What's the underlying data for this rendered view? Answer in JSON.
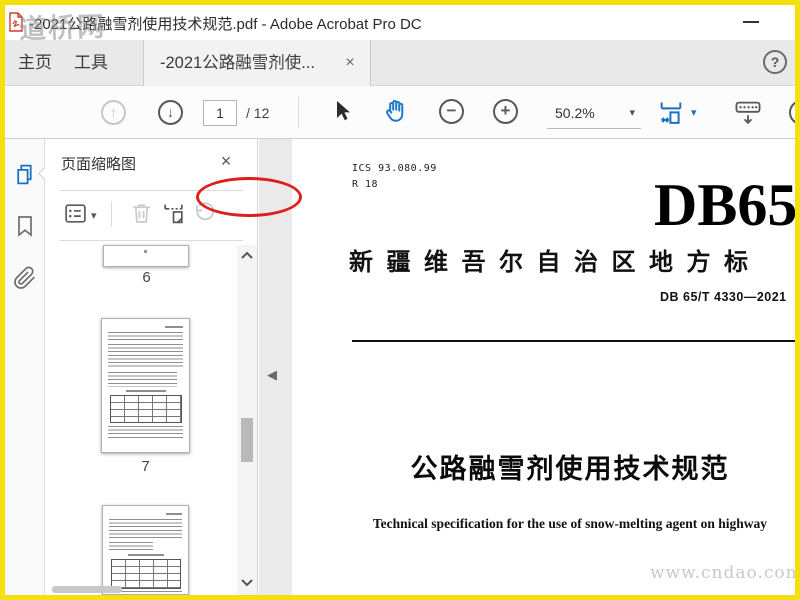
{
  "titlebar": {
    "watermark": "道桥网",
    "title": "-2021公路融雪剂使用技术规范.pdf - Adobe Acrobat Pro DC"
  },
  "tabbar": {
    "home_tab": "主页",
    "tools_tab": "工具",
    "doc_tab": "-2021公路融雪剂使...",
    "doc_tab_close": "×",
    "help": "?"
  },
  "toolbar": {
    "page_current": "1",
    "page_total": "/ 12",
    "zoom_level": "50.2%",
    "zoom_out": "−",
    "zoom_in": "+",
    "page_up": "↑",
    "page_down": "↓"
  },
  "thumbnail_panel": {
    "title": "页面缩略图",
    "close": "×",
    "thumbs": [
      {
        "label": "6"
      },
      {
        "label": "7"
      },
      {
        "label": ""
      }
    ]
  },
  "document": {
    "ics_lines": "ICS 93.080.99\nR 18",
    "code_big": "DB65",
    "org_line": "新疆维吾尔自治区地方标",
    "std_number": "DB 65/T 4330—2021",
    "title_cn": "公路融雪剂使用技术规范",
    "title_en": "Technical specification for the use of snow-melting agent on highway",
    "watermark": "www.cndao.com"
  },
  "icons": {
    "caret_down": "▾",
    "collapse_left": "◀"
  },
  "colors": {
    "frame_yellow": "#f2e10c",
    "annotation_red": "#dd1f1f",
    "acrobat_blue": "#1b6fc4"
  }
}
